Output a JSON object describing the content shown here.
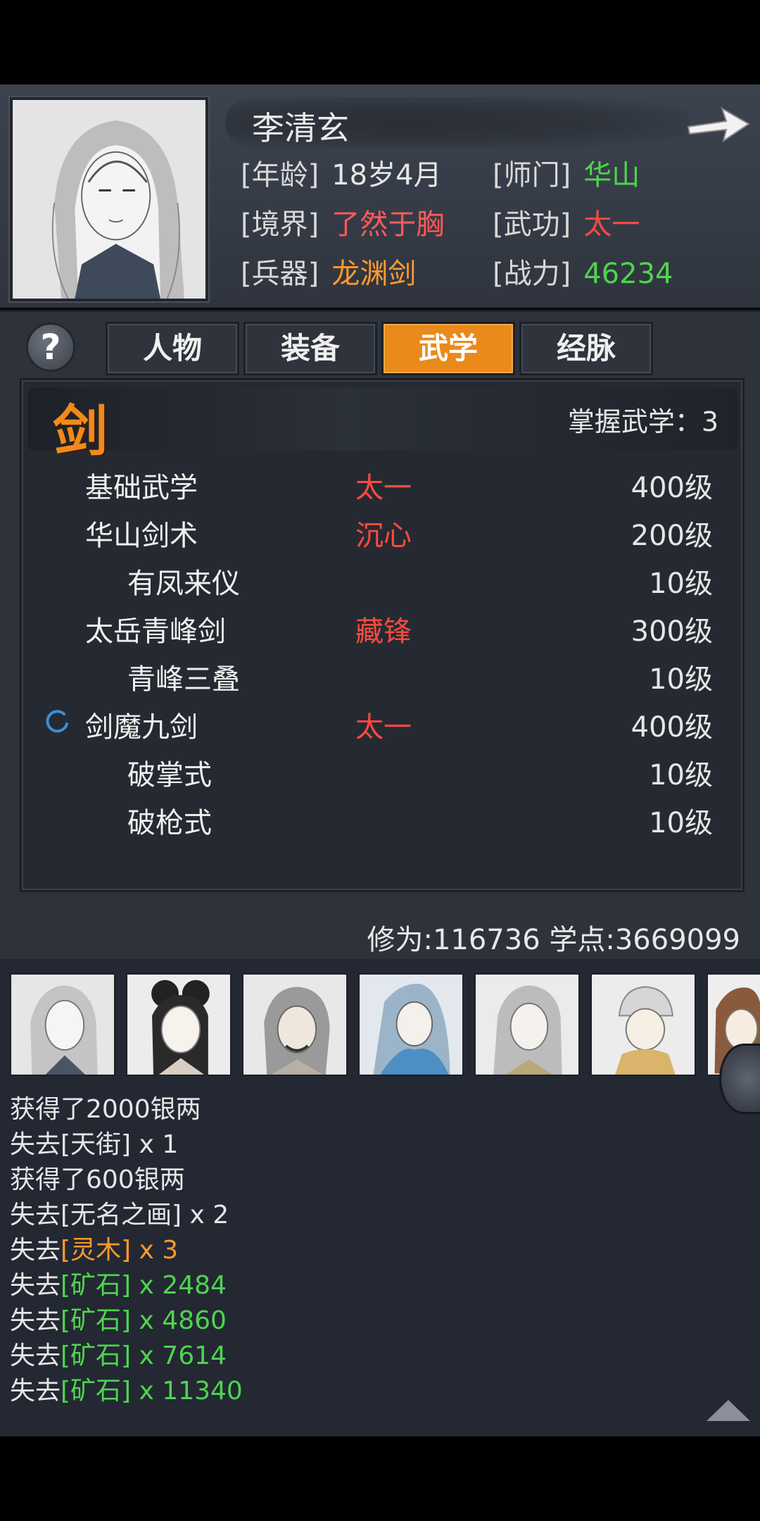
{
  "profile": {
    "name": "李清玄",
    "fields": [
      {
        "key": "[年龄]",
        "value": "18岁4月",
        "color": "#e6e6e6"
      },
      {
        "key": "[师门]",
        "value": "华山",
        "color": "#4fd44f"
      },
      {
        "key": "[境界]",
        "value": "了然于胸",
        "color": "#ff5a5a"
      },
      {
        "key": "[武功]",
        "value": "太一",
        "color": "#ff4a3d"
      },
      {
        "key": "[兵器]",
        "value": "龙渊剑",
        "color": "#ff9a2e"
      },
      {
        "key": "[战力]",
        "value": "46234",
        "color": "#4fd44f"
      }
    ]
  },
  "tabs": [
    {
      "label": "人物",
      "active": false
    },
    {
      "label": "装备",
      "active": false
    },
    {
      "label": "武学",
      "active": true
    },
    {
      "label": "经脉",
      "active": false
    }
  ],
  "help_label": "?",
  "category": {
    "char": "剑",
    "mastered_label": "掌握武学：3"
  },
  "skills": [
    {
      "name": "基础武学",
      "realm": "太一",
      "level": "400级",
      "sub": false,
      "loading": false
    },
    {
      "name": "华山剑术",
      "realm": "沉心",
      "level": "200级",
      "sub": false,
      "loading": false
    },
    {
      "name": "有凤来仪",
      "realm": "",
      "level": "10级",
      "sub": true,
      "loading": false
    },
    {
      "name": "太岳青峰剑",
      "realm": "藏锋",
      "level": "300级",
      "sub": false,
      "loading": false
    },
    {
      "name": "青峰三叠",
      "realm": "",
      "level": "10级",
      "sub": true,
      "loading": false
    },
    {
      "name": "剑魔九剑",
      "realm": "太一",
      "level": "400级",
      "sub": false,
      "loading": true
    },
    {
      "name": "破掌式",
      "realm": "",
      "level": "10级",
      "sub": true,
      "loading": false
    },
    {
      "name": "破枪式",
      "realm": "",
      "level": "10级",
      "sub": true,
      "loading": false
    }
  ],
  "stats": {
    "text": "修为:116736  学点:3669099"
  },
  "log": [
    {
      "pre": "获得了2000银两",
      "item": "",
      "post": "",
      "color": ""
    },
    {
      "pre": "失去",
      "item": "[天街]",
      "post": " x 1",
      "color": ""
    },
    {
      "pre": "获得了600银两",
      "item": "",
      "post": "",
      "color": ""
    },
    {
      "pre": "失去",
      "item": "[无名之画]",
      "post": " x 2",
      "color": ""
    },
    {
      "pre": "失去",
      "item": "[灵木]",
      "post": " x 3",
      "color": "orange"
    },
    {
      "pre": "失去",
      "item": "[矿石]",
      "post": " x 2484",
      "color": "green"
    },
    {
      "pre": "失去",
      "item": "[矿石]",
      "post": " x 4860",
      "color": "green"
    },
    {
      "pre": "失去",
      "item": "[矿石]",
      "post": " x 7614",
      "color": "green"
    },
    {
      "pre": "失去",
      "item": "[矿石]",
      "post": " x 11340",
      "color": "green"
    }
  ]
}
